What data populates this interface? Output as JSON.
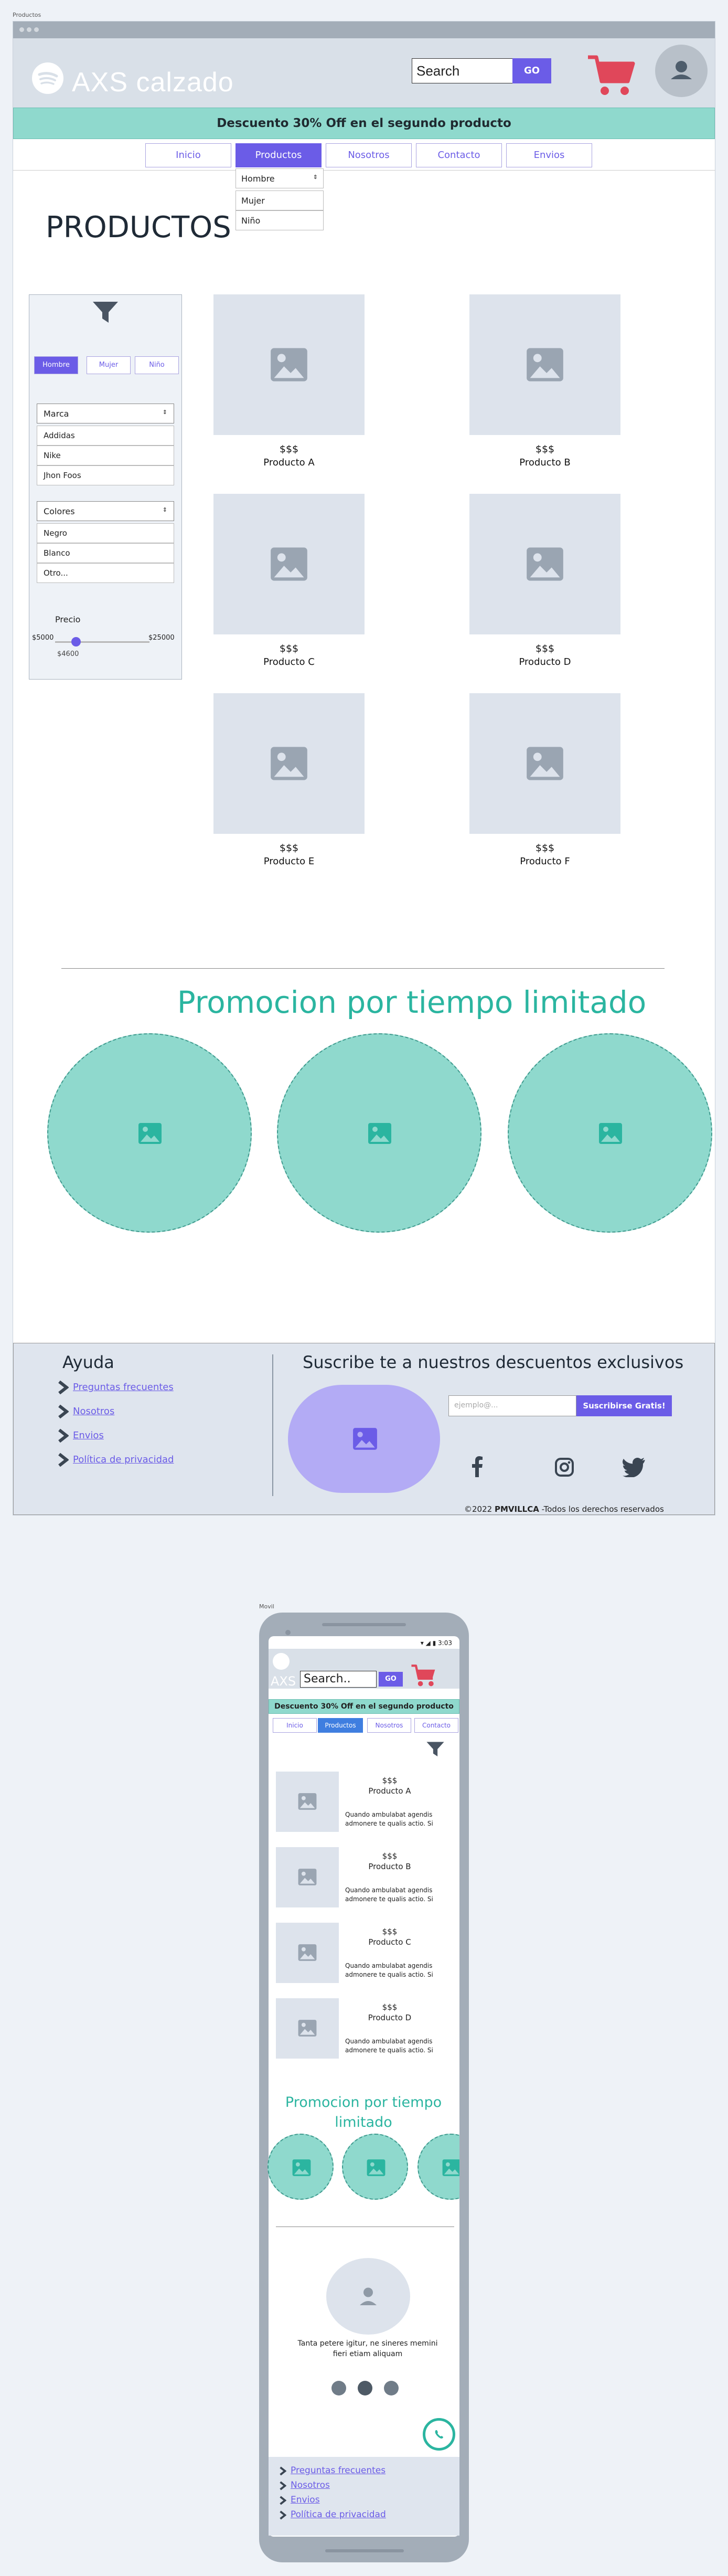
{
  "desktop": {
    "frame_label": "Productos",
    "brand": "AXS calzado",
    "search": {
      "value": "Search",
      "button": "GO"
    },
    "promo_banner": "Descuento 30% Off en el segundo producto",
    "nav": [
      "Inicio",
      "Productos",
      "Nosotros",
      "Contacto",
      "Envios"
    ],
    "nav_active": "Productos",
    "nav_dropdown": [
      "Hombre",
      "Mujer",
      "Niño"
    ],
    "page_title": "PRODUCTOS",
    "filters": {
      "gender_buttons": [
        "Hombre",
        "Mujer",
        "Niño"
      ],
      "gender_active": "Hombre",
      "brand_select": "Marca",
      "brand_options": [
        "Addidas",
        "Nike",
        "Jhon Foos"
      ],
      "color_select": "Colores",
      "color_options": [
        "Negro",
        "Blanco",
        "Otro..."
      ],
      "price_label": "Precio",
      "price_min": "$5000",
      "price_max": "$25000",
      "price_current": "$4600",
      "price_fraction": 0.22
    },
    "products": [
      {
        "price": "$$$",
        "name": "Producto A"
      },
      {
        "price": "$$$",
        "name": "Producto B"
      },
      {
        "price": "$$$",
        "name": "Producto C"
      },
      {
        "price": "$$$",
        "name": "Producto D"
      },
      {
        "price": "$$$",
        "name": "Producto E"
      },
      {
        "price": "$$$",
        "name": "Producto F"
      }
    ],
    "promo_title": "Promocion  por tiempo limitado",
    "footer": {
      "help_title": "Ayuda",
      "links": [
        "Preguntas frecuentes",
        "Nosotros",
        "Envios",
        "Política de privacidad"
      ],
      "subscribe_title": "Suscribe te a nuestros descuentos exclusivos",
      "email_placeholder": "ejemplo@...",
      "subscribe_button": "Suscribirse Gratis!",
      "copyright_prefix": "©2022",
      "copyright_brand": "PMVILLCA",
      "copyright_suffix": "-Todos los derechos reservados"
    }
  },
  "mobile": {
    "frame_label": "Movil",
    "status_time": "3:03",
    "brand": "AXS",
    "search": {
      "value": "Search..",
      "button": "GO"
    },
    "promo_banner": "Descuento 30% Off en el segundo producto",
    "nav": [
      "Inicio",
      "Productos",
      "Nosotros",
      "Contacto"
    ],
    "nav_active": "Productos",
    "products": [
      {
        "price": "$$$",
        "name": "Producto A",
        "desc": "Quando ambulabat agendis admonere te qualis actio. Si"
      },
      {
        "price": "$$$",
        "name": "Producto B",
        "desc": "Quando ambulabat agendis admonere te qualis actio. Si"
      },
      {
        "price": "$$$",
        "name": "Producto C",
        "desc": "Quando ambulabat agendis admonere te qualis actio. Si"
      },
      {
        "price": "$$$",
        "name": "Producto D",
        "desc": "Quando ambulabat agendis admonere te qualis actio. Si"
      }
    ],
    "promo_title": "Promocion  por tiempo limitado",
    "testimonial": "Tanta petere igitur, ne sineres memini fieri etiam aliquam",
    "footer_links": [
      "Preguntas frecuentes",
      "Nosotros",
      "Envios",
      "Política de privacidad"
    ]
  },
  "colors": {
    "accent": "#6b5ce7",
    "teal": "#8fd9cd",
    "cart": "#e0475a",
    "teal_text": "#2bb5a0"
  }
}
